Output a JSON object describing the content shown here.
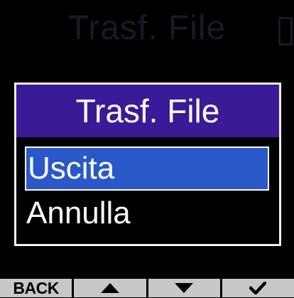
{
  "background": {
    "title": "Trasf. File"
  },
  "dialog": {
    "title": "Trasf. File",
    "options": [
      {
        "label": "Uscita",
        "selected": true
      },
      {
        "label": "Annulla",
        "selected": false
      }
    ]
  },
  "softkeys": {
    "back_label": "BACK",
    "up_icon": "up-arrow-icon",
    "down_icon": "down-arrow-icon",
    "confirm_icon": "check-icon"
  },
  "colors": {
    "header": "#3a1a96",
    "selection": "#2b58c8",
    "softkey_bg": "#c8c8c8"
  }
}
